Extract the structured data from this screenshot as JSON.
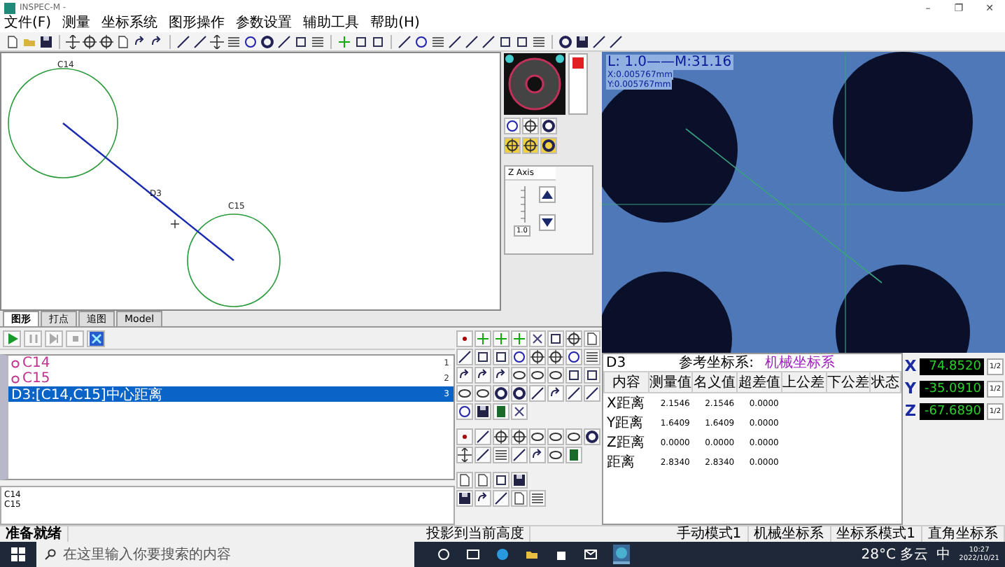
{
  "window": {
    "title": "INSPEC-M -",
    "controls": [
      "–",
      "❐",
      "✕"
    ]
  },
  "menu": [
    "文件(F)",
    "测量",
    "坐标系统",
    "图形操作",
    "参数设置",
    "辅助工具",
    "帮助(H)"
  ],
  "canvas": {
    "labels": [
      {
        "text": "C14",
        "kind": "circle"
      },
      {
        "text": "C15",
        "kind": "circle"
      },
      {
        "text": "D3",
        "kind": "line"
      }
    ]
  },
  "z_axis": {
    "title": "Z Axis",
    "value": "1.0"
  },
  "camera": {
    "lines": [
      "L: 1.0——M:31.16",
      "X:0.005767mm",
      "Y:0.005767mm"
    ]
  },
  "tabs": [
    {
      "label": "图形",
      "selected": true
    },
    {
      "label": "打点",
      "selected": false
    },
    {
      "label": "追图",
      "selected": false
    },
    {
      "label": "Model",
      "selected": false
    }
  ],
  "features": [
    {
      "name": "C14",
      "index": "1",
      "selected": false
    },
    {
      "name": "C15",
      "index": "2",
      "selected": false
    },
    {
      "name": "D3:[C14,C15]中心距离",
      "index": "3",
      "selected": true
    }
  ],
  "notes": [
    "C14",
    "C15"
  ],
  "results": {
    "feature": "D3",
    "ref_label": "参考坐标系:",
    "ref_value": "机械坐标系",
    "columns": [
      "内容",
      "测量值",
      "名义值",
      "超差值",
      "上公差",
      "下公差",
      "状态"
    ],
    "rows": [
      [
        "X距离",
        "2.1546",
        "2.1546",
        "0.0000"
      ],
      [
        "Y距离",
        "1.6409",
        "1.6409",
        "0.0000"
      ],
      [
        "Z距离",
        "0.0000",
        "0.0000",
        "0.0000"
      ],
      [
        "距离",
        "2.8340",
        "2.8340",
        "0.0000"
      ]
    ]
  },
  "dro": [
    {
      "axis": "X",
      "value": "74.8520",
      "button": "1/2"
    },
    {
      "axis": "Y",
      "value": "-35.0910",
      "button": "1/2"
    },
    {
      "axis": "Z",
      "value": "-67.6890",
      "button": "1/2"
    }
  ],
  "status_bar": [
    "准备就绪",
    "投影到当前高度",
    "手动模式1",
    "机械坐标系",
    "坐标系模式1",
    "直角坐标系"
  ],
  "taskbar": {
    "search": "在这里输入你要搜索的内容",
    "weather": "28°C 多云",
    "ime": "中",
    "time": "10:27",
    "date": "2022/10/21"
  }
}
